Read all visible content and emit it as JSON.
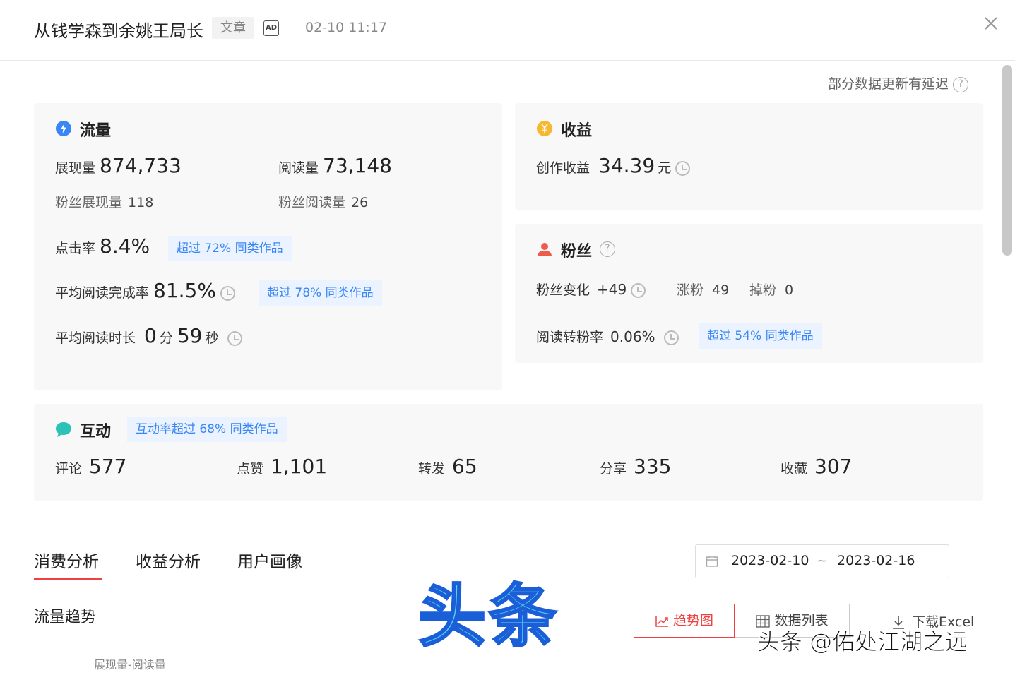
{
  "header": {
    "title": "从钱学森到余姚王局长",
    "tag": "文章",
    "ad_label": "AD",
    "time": "02-10 11:17"
  },
  "delay_note": "部分数据更新有延迟",
  "traffic": {
    "title": "流量",
    "impressions_label": "展现量",
    "impressions": "874,733",
    "reads_label": "阅读量",
    "reads": "73,148",
    "fan_impressions_label": "粉丝展现量",
    "fan_impressions": "118",
    "fan_reads_label": "粉丝阅读量",
    "fan_reads": "26",
    "ctr_label": "点击率",
    "ctr": "8.4%",
    "ctr_badge": "超过 72% 同类作品",
    "completion_label": "平均阅读完成率",
    "completion": "81.5%",
    "completion_badge": "超过 78% 同类作品",
    "duration_label": "平均阅读时长",
    "duration_min": "0",
    "min_unit": "分",
    "duration_sec": "59",
    "sec_unit": "秒"
  },
  "income": {
    "title": "收益",
    "label": "创作收益",
    "value": "34.39",
    "unit": "元"
  },
  "fans": {
    "title": "粉丝",
    "change_label": "粉丝变化",
    "change": "+49",
    "gain_label": "涨粉",
    "gain": "49",
    "loss_label": "掉粉",
    "loss": "0",
    "conv_label": "阅读转粉率",
    "conv": "0.06%",
    "conv_badge": "超过 54% 同类作品"
  },
  "interaction": {
    "title": "互动",
    "badge": "互动率超过 68% 同类作品",
    "items": [
      {
        "label": "评论",
        "value": "577"
      },
      {
        "label": "点赞",
        "value": "1,101"
      },
      {
        "label": "转发",
        "value": "65"
      },
      {
        "label": "分享",
        "value": "335"
      },
      {
        "label": "收藏",
        "value": "307"
      }
    ]
  },
  "tabs": [
    "消费分析",
    "收益分析",
    "用户画像"
  ],
  "date_range": {
    "start": "2023-02-10",
    "sep": "~",
    "end": "2023-02-16"
  },
  "section_title": "流量趋势",
  "buttons": {
    "trend": "趋势图",
    "list": "数据列表",
    "excel": "下载Excel"
  },
  "chart_label": "展现量-阅读量",
  "watermark": {
    "big": "头条",
    "small": "头条 @佑处江湖之远"
  },
  "colors": {
    "accent": "#f04142",
    "badge_text": "#3a86f5",
    "badge_bg": "#eaf3ff",
    "card_bg": "#f8f8f8"
  }
}
